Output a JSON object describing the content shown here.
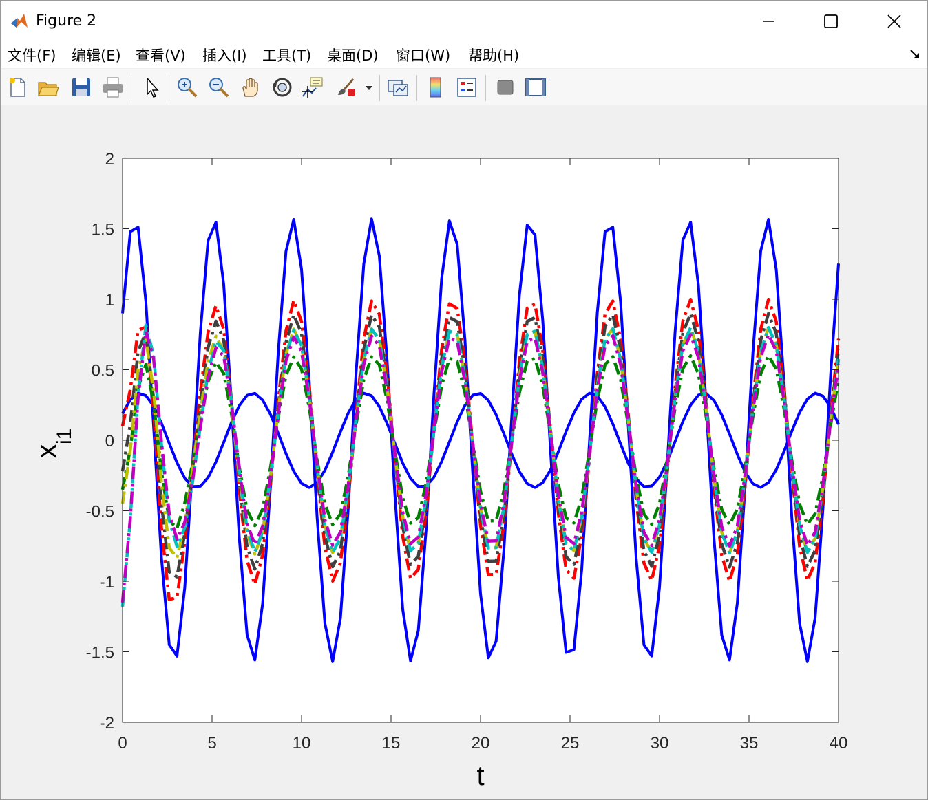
{
  "window": {
    "title": "Figure 2"
  },
  "menu": [
    "文件(F)",
    "编辑(E)",
    "查看(V)",
    "插入(I)",
    "工具(T)",
    "桌面(D)",
    "窗口(W)",
    "帮助(H)"
  ],
  "toolbar": {
    "icons": [
      "new-figure-icon",
      "open-file-icon",
      "save-icon",
      "print-icon",
      "pointer-icon",
      "zoom-in-icon",
      "zoom-out-icon",
      "pan-hand-icon",
      "rotate-3d-icon",
      "data-cursor-icon",
      "brush-icon",
      "brush-dropdown-icon",
      "link-plot-icon",
      "colorbar-icon",
      "legend-icon",
      "hide-plot-tools-icon",
      "show-plot-tools-icon"
    ]
  },
  "chart_data": {
    "type": "line",
    "xlabel": "t",
    "ylabel": "x",
    "ylabel_sub": "i1",
    "xlim": [
      0,
      40
    ],
    "ylim": [
      -2,
      2
    ],
    "xticks": [
      "0",
      "5",
      "10",
      "15",
      "20",
      "25",
      "30",
      "35",
      "40"
    ],
    "yticks": [
      "2",
      "1.5",
      "1",
      "0.5",
      "0",
      "-0.5",
      "-1",
      "-1.5",
      "-2"
    ],
    "grid": false,
    "series": [
      {
        "style": "solid",
        "color": "#0000ff",
        "amp": 1.57,
        "period": 4.42,
        "phase0": 0.9,
        "x0": 0,
        "xmax": 40
      },
      {
        "style": "solid",
        "color": "#0000ff",
        "amp": 0.335,
        "period": 6.3,
        "phase0": 0.19,
        "x0": 0,
        "xmax": 40
      },
      {
        "style": "dashdot",
        "color": "#ff0000",
        "amp": 1.0,
        "period": 4.42,
        "init": 0.1,
        "x0": 0,
        "xmax": 40
      },
      {
        "style": "dashdot",
        "color": "#404040",
        "amp": 0.9,
        "period": 4.42,
        "init": -0.22,
        "x0": 0,
        "xmax": 40
      },
      {
        "style": "dashdot",
        "color": "#008000",
        "amp": 0.6,
        "period": 4.42,
        "init": -0.35,
        "x0": 0,
        "xmax": 40
      },
      {
        "style": "dashdot",
        "color": "#c0c000",
        "amp": 0.8,
        "period": 4.42,
        "init": -0.45,
        "x0": 0,
        "xmax": 40
      },
      {
        "style": "dashdot",
        "color": "#00c0c0",
        "amp": 0.8,
        "period": 4.42,
        "init": -1.18,
        "x0": 0,
        "xmax": 40
      },
      {
        "style": "dashdot",
        "color": "#c000c0",
        "amp": 0.75,
        "period": 4.42,
        "init": -1.15,
        "x0": 0,
        "xmax": 40
      }
    ]
  }
}
